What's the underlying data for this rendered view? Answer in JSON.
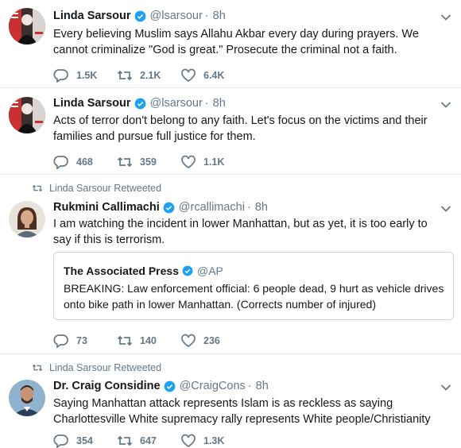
{
  "colors": {
    "verified_blue": "#1da1f2",
    "muted_text": "#657786",
    "divider": "#e6ecf0"
  },
  "tweets": [
    {
      "author_name": "Linda Sarsour",
      "handle": "@lsarsour",
      "separator": "·",
      "time": "8h",
      "text": "Every believing Muslim says Allahu Akbar every day during prayers. We cannot criminalize \"God is great.\" Prosecute the criminal not a faith.",
      "replies": "1.5K",
      "retweets": "2.1K",
      "likes": "6.4K"
    },
    {
      "author_name": "Linda Sarsour",
      "handle": "@lsarsour",
      "separator": "·",
      "time": "8h",
      "text": "Acts of terror don't belong to any faith. Let's focus on the victims and their families and pursue full justice for them.",
      "replies": "468",
      "retweets": "359",
      "likes": "1.1K"
    },
    {
      "retweeted_by": "Linda Sarsour Retweeted",
      "author_name": "Rukmini Callimachi",
      "handle": "@rcallimachi",
      "separator": "·",
      "time": "8h",
      "text": "I am watching the incident in lower Manhattan, but as yet, it is too early to say if this is terrorism.",
      "quote": {
        "author_name": "The Associated Press",
        "handle": "@AP",
        "text": "BREAKING: Law enforcement official: 6 people dead, 9 hurt as vehicle drives onto bike path in lower Manhattan. (Corrects number of injured)"
      },
      "replies": "73",
      "retweets": "140",
      "likes": "236"
    },
    {
      "retweeted_by": "Linda Sarsour Retweeted",
      "author_name": "Dr. Craig Considine",
      "handle": "@CraigCons",
      "separator": "·",
      "time": "8h",
      "text": "Saying Manhattan attack represents Islam is as reckless as saying Charlottesville White supremacy rally represents White people/Christianity",
      "replies": "354",
      "retweets": "647",
      "likes": "1.3K"
    }
  ]
}
